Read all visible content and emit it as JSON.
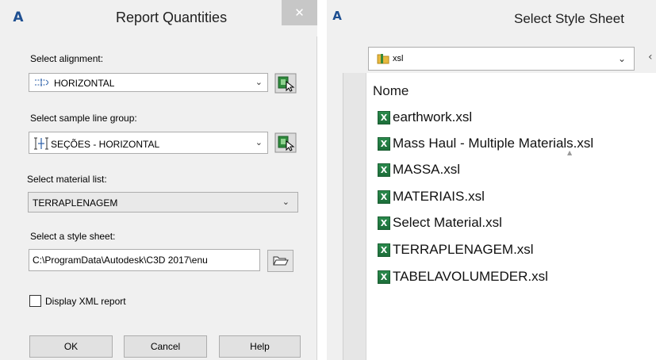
{
  "report_dialog": {
    "title": "Report Quantities",
    "close_glyph": "✕",
    "alignment": {
      "label": "Select alignment:",
      "value": "HORIZONTAL",
      "icon": "alignment-icon"
    },
    "sample_line_group": {
      "label": "Select sample line group:",
      "value": "SEÇÕES - HORIZONTAL",
      "icon": "sample-line-icon"
    },
    "material_list": {
      "label": "Select material list:",
      "value": "TERRAPLENAGEM"
    },
    "style_sheet": {
      "label": "Select a style sheet:",
      "value": "C:\\ProgramData\\Autodesk\\C3D 2017\\enu"
    },
    "display_xml": {
      "label": "Display XML report",
      "checked": false
    },
    "buttons": {
      "ok": "OK",
      "cancel": "Cancel",
      "help": "Help"
    }
  },
  "style_dialog": {
    "title": "Select Style Sheet",
    "folder": "xsl",
    "column_header": "Nome",
    "files": [
      "earthwork.xsl",
      "Mass Haul - Multiple Materials.xsl",
      "MASSA.xsl",
      "MATERIAIS.xsl",
      "Select Material.xsl",
      "TERRAPLENAGEM.xsl",
      "TABELAVOLUMEDER.xsl"
    ]
  },
  "colors": {
    "app_icon": "#1e4f91",
    "excel_green": "#1d6e3a",
    "dialog_bg": "#f0f0f0"
  }
}
